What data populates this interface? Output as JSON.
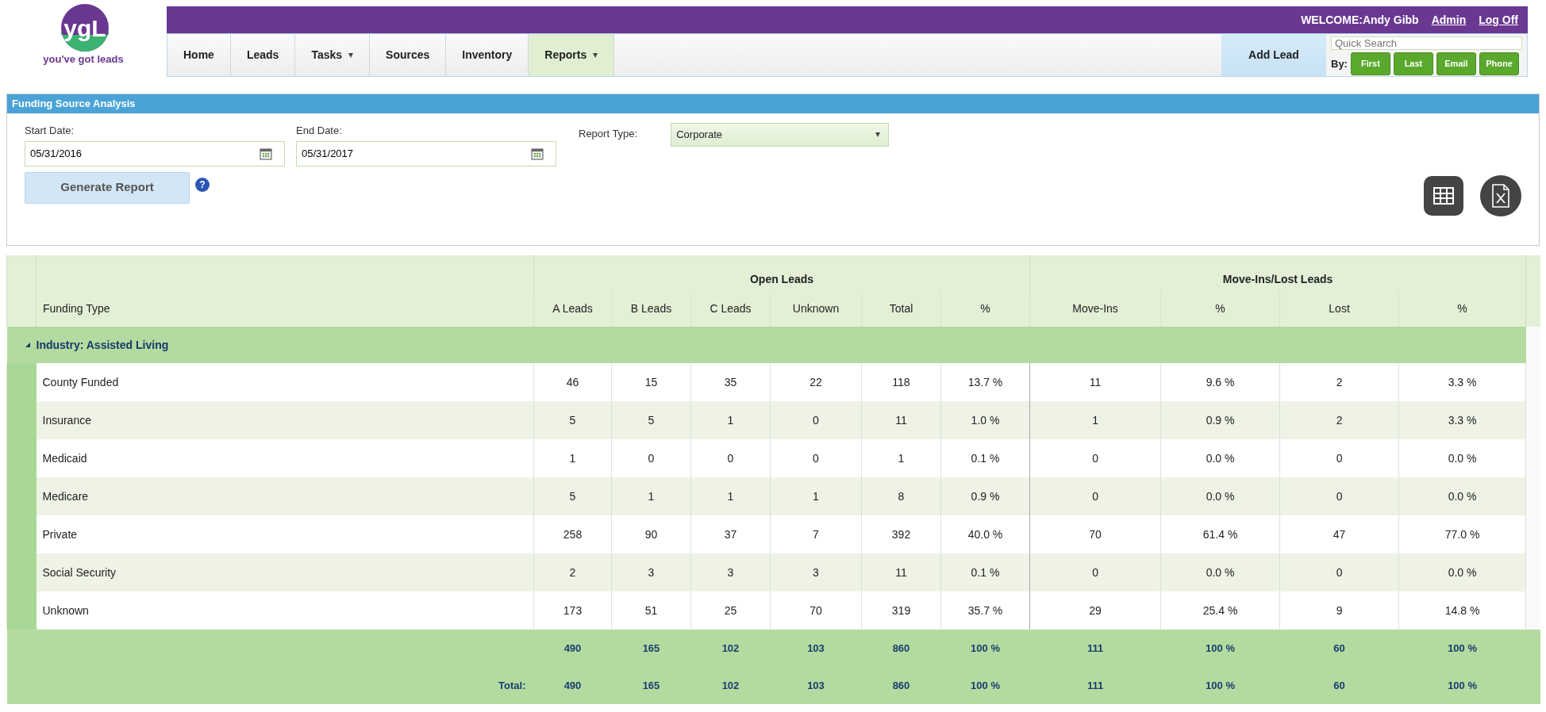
{
  "logo": {
    "mark": "ygL",
    "tagline": "you've got leads"
  },
  "user_bar": {
    "welcome": "WELCOME:Andy Gibb",
    "links": [
      "Admin",
      "Log Off"
    ]
  },
  "nav": [
    {
      "label": "Home",
      "selected": false,
      "dropdown": false
    },
    {
      "label": "Leads",
      "selected": false,
      "dropdown": false
    },
    {
      "label": "Tasks",
      "selected": false,
      "dropdown": true
    },
    {
      "label": "Sources",
      "selected": false,
      "dropdown": false
    },
    {
      "label": "Inventory",
      "selected": false,
      "dropdown": false
    },
    {
      "label": "Reports",
      "selected": true,
      "dropdown": true
    }
  ],
  "add_lead": "Add Lead",
  "quick_search": {
    "placeholder": "Quick Search",
    "by_label": "By:",
    "buttons": [
      "First",
      "Last",
      "Email",
      "Phone"
    ]
  },
  "panel": {
    "title": "Funding Source Analysis",
    "start_date": {
      "label": "Start Date:",
      "value": "05/31/2016"
    },
    "end_date": {
      "label": "End Date:",
      "value": "05/31/2017"
    },
    "report_type": {
      "label": "Report Type:",
      "value": "Corporate"
    },
    "generate_button": "Generate Report",
    "help": "?"
  },
  "table": {
    "row_header": "Funding Type",
    "groups": [
      {
        "label": "Open Leads",
        "columns": [
          "A Leads",
          "B Leads",
          "C Leads",
          "Unknown",
          "Total",
          "%"
        ]
      },
      {
        "label": "Move-Ins/Lost Leads",
        "columns": [
          "Move-Ins",
          "%",
          "Lost",
          "%"
        ]
      }
    ],
    "section": {
      "label": "Industry: Assisted Living",
      "expanded": true
    },
    "rows": [
      {
        "name": "County Funded",
        "values": [
          "46",
          "15",
          "35",
          "22",
          "118",
          "13.7 %",
          "11",
          "9.6 %",
          "2",
          "3.3 %"
        ]
      },
      {
        "name": "Insurance",
        "values": [
          "5",
          "5",
          "1",
          "0",
          "11",
          "1.0 %",
          "1",
          "0.9 %",
          "2",
          "3.3 %"
        ]
      },
      {
        "name": "Medicaid",
        "values": [
          "1",
          "0",
          "0",
          "0",
          "1",
          "0.1 %",
          "0",
          "0.0 %",
          "0",
          "0.0 %"
        ]
      },
      {
        "name": "Medicare",
        "values": [
          "5",
          "1",
          "1",
          "1",
          "8",
          "0.9 %",
          "0",
          "0.0 %",
          "0",
          "0.0 %"
        ]
      },
      {
        "name": "Private",
        "values": [
          "258",
          "90",
          "37",
          "7",
          "392",
          "40.0 %",
          "70",
          "61.4 %",
          "47",
          "77.0 %"
        ]
      },
      {
        "name": "Social Security",
        "values": [
          "2",
          "3",
          "3",
          "3",
          "11",
          "0.1 %",
          "0",
          "0.0 %",
          "0",
          "0.0 %"
        ]
      },
      {
        "name": "Unknown",
        "values": [
          "173",
          "51",
          "25",
          "70",
          "319",
          "35.7 %",
          "29",
          "25.4 %",
          "9",
          "14.8 %"
        ]
      }
    ],
    "subtotal": [
      "490",
      "165",
      "102",
      "103",
      "860",
      "100 %",
      "111",
      "100 %",
      "60",
      "100 %"
    ],
    "total": {
      "label": "Total:",
      "values": [
        "490",
        "165",
        "102",
        "103",
        "860",
        "100 %",
        "111",
        "100 %",
        "60",
        "100 %"
      ]
    }
  }
}
